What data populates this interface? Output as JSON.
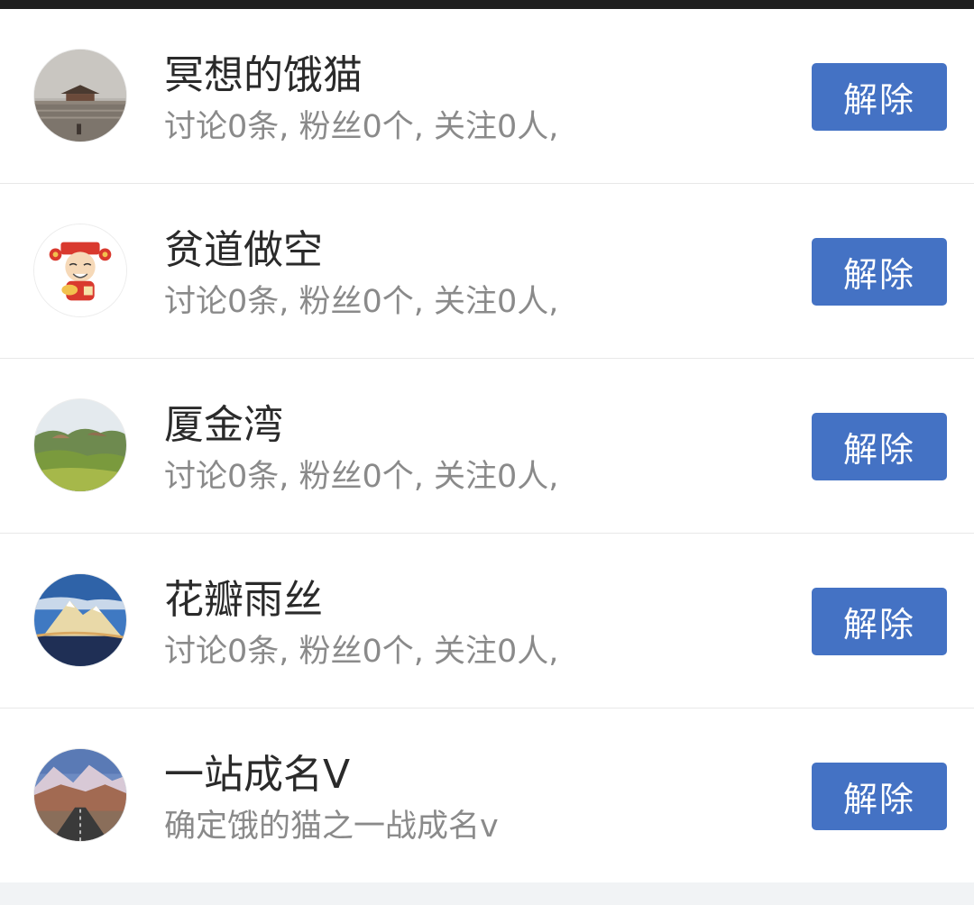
{
  "users": [
    {
      "name": "冥想的饿猫",
      "description": "讨论0条, 粉丝0个, 关注0人,",
      "action_label": "解除",
      "avatar_icon": "palace-photo-avatar"
    },
    {
      "name": "贫道做空",
      "description": "讨论0条, 粉丝0个, 关注0人,",
      "action_label": "解除",
      "avatar_icon": "fortune-god-cartoon-avatar"
    },
    {
      "name": "厦金湾",
      "description": "讨论0条, 粉丝0个, 关注0人,",
      "action_label": "解除",
      "avatar_icon": "green-hills-photo-avatar"
    },
    {
      "name": "花瓣雨丝",
      "description": "讨论0条, 粉丝0个, 关注0人,",
      "action_label": "解除",
      "avatar_icon": "snow-mountain-photo-avatar"
    },
    {
      "name": "一站成名V",
      "description": "确定饿的猫之一战成名v",
      "action_label": "解除",
      "avatar_icon": "mountain-road-photo-avatar"
    }
  ],
  "colors": {
    "button": "#4472c4",
    "name_text": "#2a2a2a",
    "desc_text": "#8a8a8a"
  }
}
